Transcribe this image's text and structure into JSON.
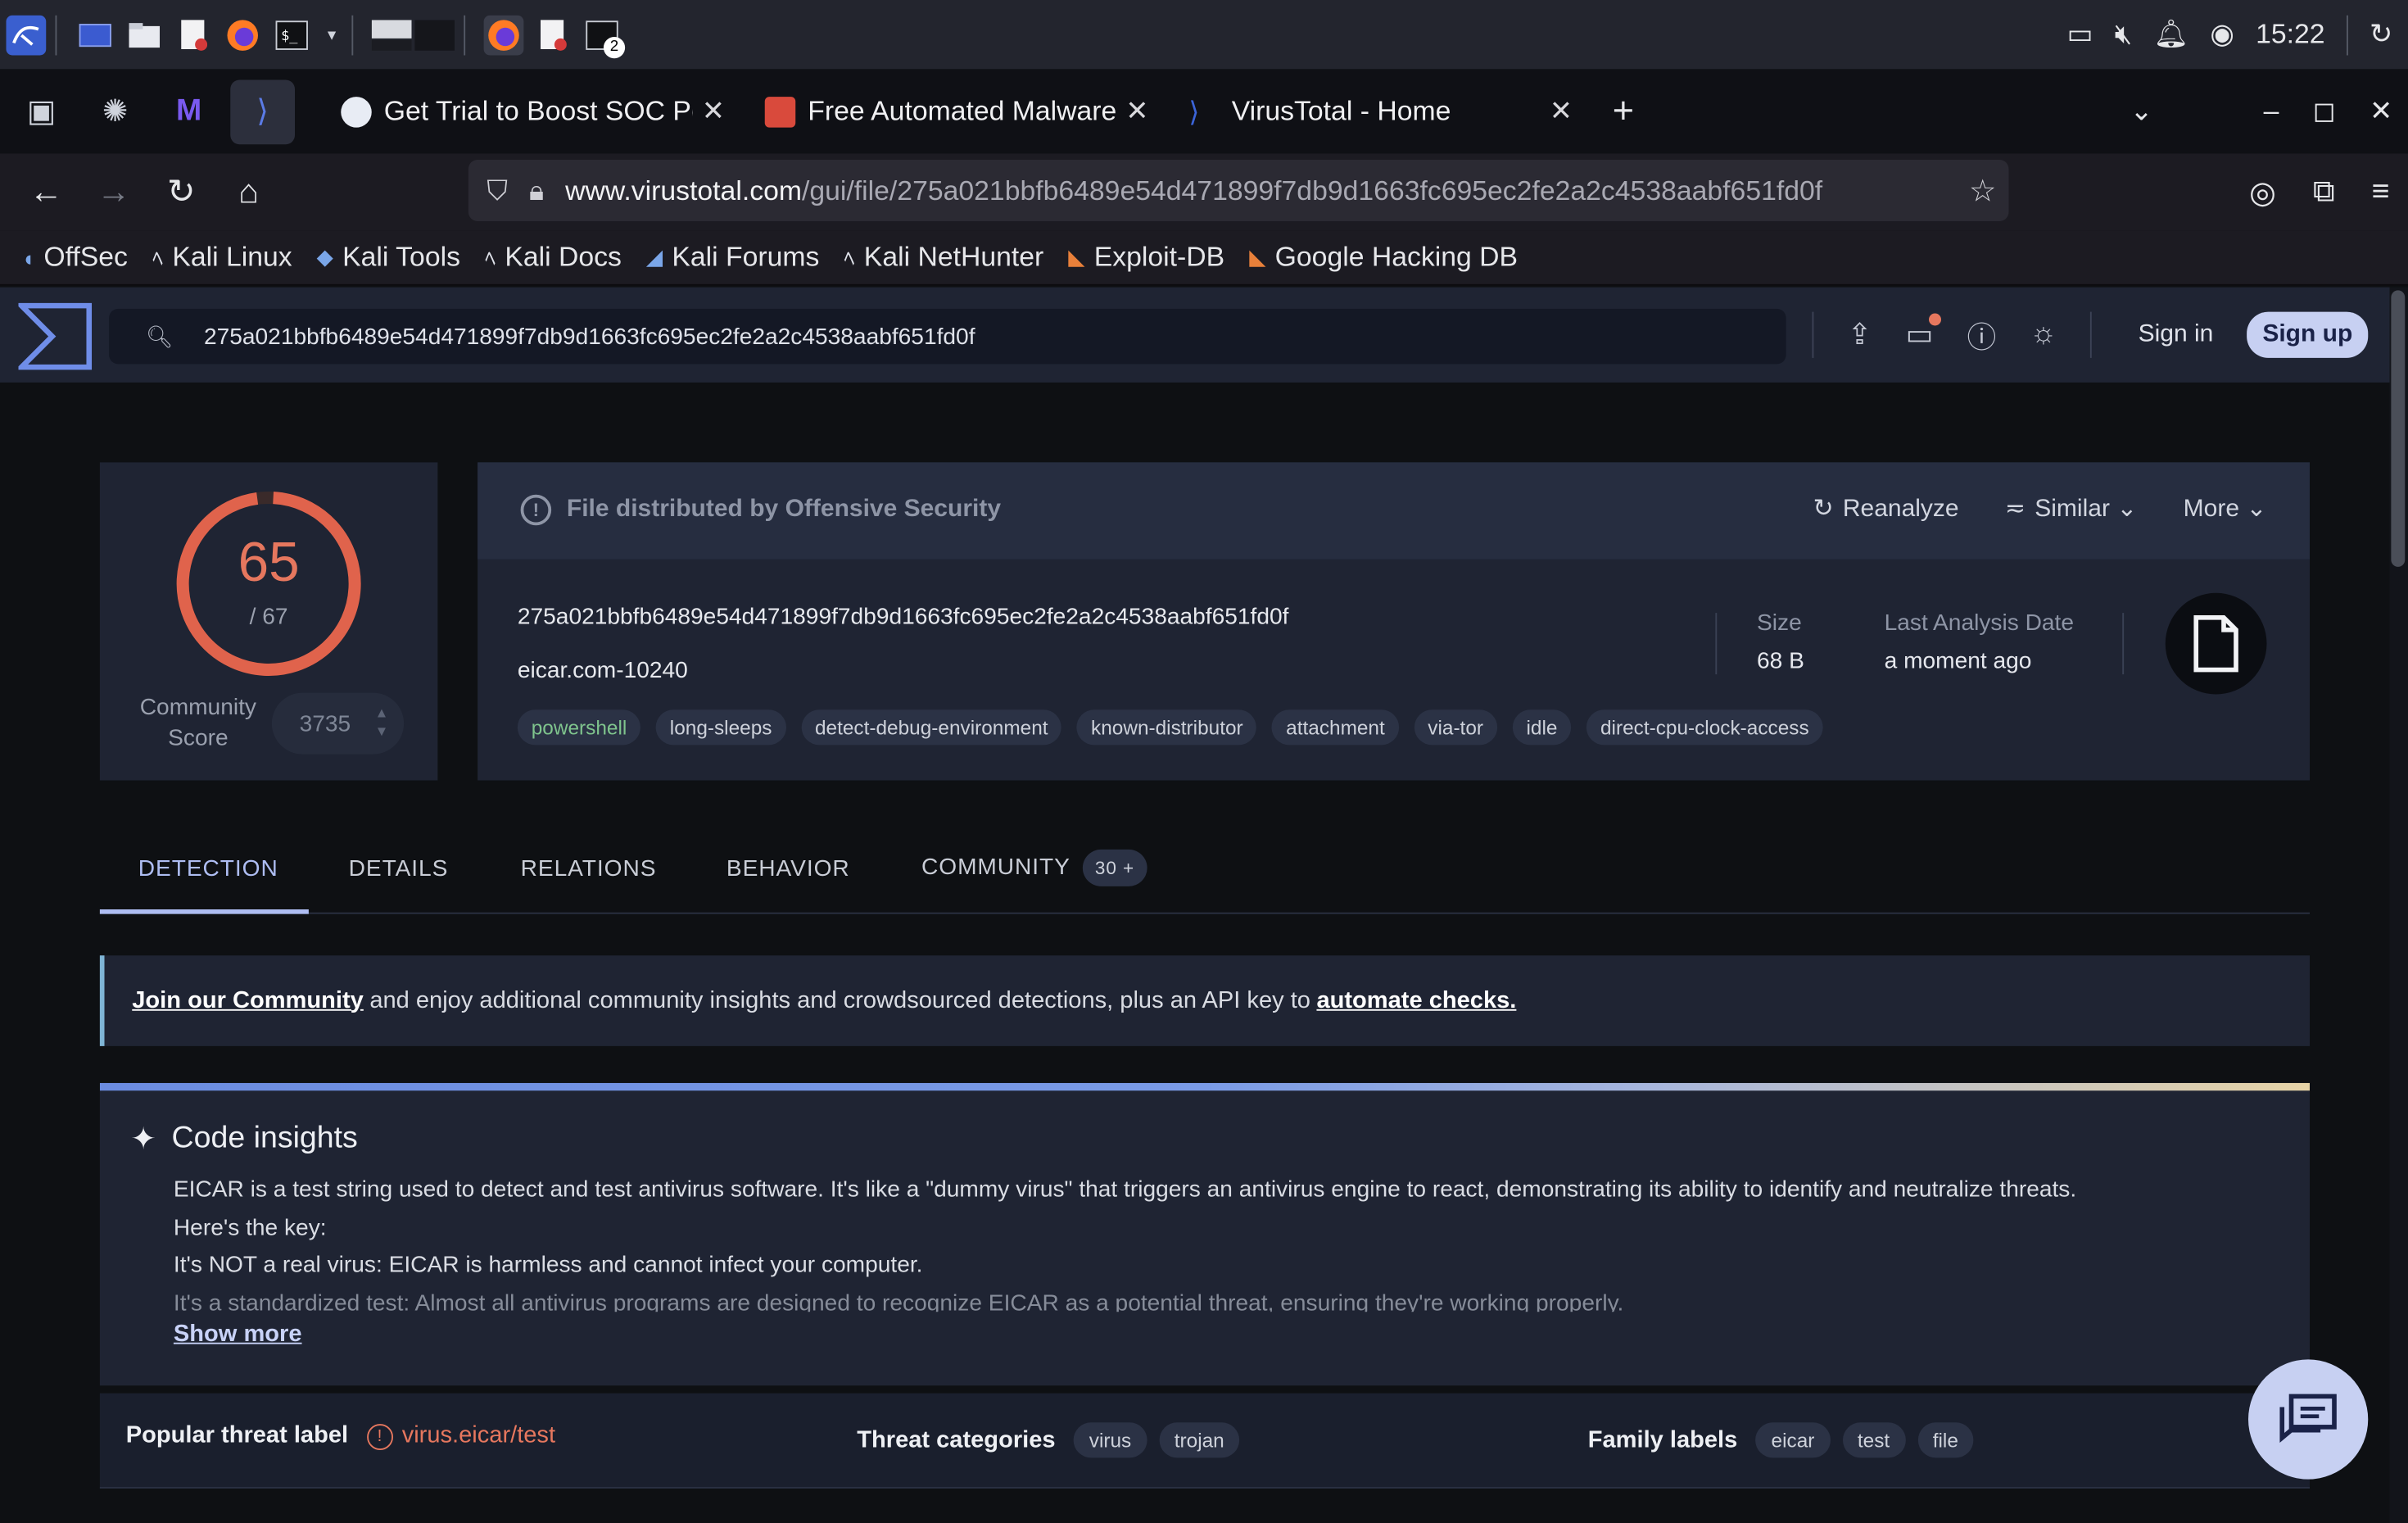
{
  "taskbar": {
    "clock": "15:22",
    "badge_count": "2"
  },
  "browser": {
    "tabs": [
      {
        "title": "Get Trial to Boost SOC Pe",
        "favicon_color": "#e8ecf4"
      },
      {
        "title": "Free Automated Malware",
        "favicon_color": "#d94a3c"
      },
      {
        "title": "VirusTotal - Home",
        "favicon_color": "#3b64d8"
      }
    ],
    "url_host": "www.virustotal.com",
    "url_path": "/gui/file/275a021bbfb6489e54d471899f7db9d1663fc695ec2fe2a2c4538aabf651fd0f",
    "bookmarks": [
      "OffSec",
      "Kali Linux",
      "Kali Tools",
      "Kali Docs",
      "Kali Forums",
      "Kali NetHunter",
      "Exploit-DB",
      "Google Hacking DB"
    ]
  },
  "vt_header": {
    "search_value": "275a021bbfb6489e54d471899f7db9d1663fc695ec2fe2a2c4538aabf651fd0f",
    "sign_in": "Sign in",
    "sign_up": "Sign up"
  },
  "score": {
    "detections": "65",
    "total": "/ 67",
    "detection_ratio": 0.97,
    "community_label": "Community Score",
    "community_score": "3735",
    "ring_color": "#e0634c"
  },
  "file": {
    "notice": "File distributed by Offensive Security",
    "reanalyze": "Reanalyze",
    "similar": "Similar",
    "more": "More",
    "sha256": "275a021bbfb6489e54d471899f7db9d1663fc695ec2fe2a2c4538aabf651fd0f",
    "name": "eicar.com-10240",
    "tags": [
      "powershell",
      "long-sleeps",
      "detect-debug-environment",
      "known-distributor",
      "attachment",
      "via-tor",
      "idle",
      "direct-cpu-clock-access"
    ],
    "size_label": "Size",
    "size_value": "68 B",
    "date_label": "Last Analysis Date",
    "date_value": "a moment ago"
  },
  "nav_tabs": {
    "detection": "DETECTION",
    "details": "DETAILS",
    "relations": "RELATIONS",
    "behavior": "BEHAVIOR",
    "community": "COMMUNITY",
    "community_badge": "30 +"
  },
  "banner": {
    "link1": "Join our Community",
    "text": "and enjoy additional community insights and crowdsourced detections, plus an API key to",
    "link2": "automate checks."
  },
  "insights": {
    "title": "Code insights",
    "line1": "EICAR is a test string used to detect and test antivirus software. It's like a \"dummy virus\" that triggers an antivirus engine to react, demonstrating its ability to identify and neutralize threats.",
    "line2": "Here's the key:",
    "line3": "It's NOT a real virus: EICAR is harmless and cannot infect your computer.",
    "line4": "It's a standardized test: Almost all antivirus programs are designed to recognize EICAR as a potential threat, ensuring they're working properly.",
    "show_more": "Show more"
  },
  "threat": {
    "popular_label": "Popular threat label",
    "popular_value": "virus.eicar/test",
    "categories_label": "Threat categories",
    "categories": [
      "virus",
      "trojan"
    ],
    "family_label": "Family labels",
    "families": [
      "eicar",
      "test",
      "file"
    ]
  }
}
